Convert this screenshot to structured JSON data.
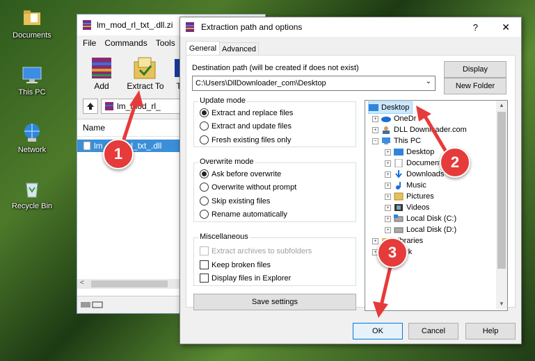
{
  "desktop": {
    "icons": [
      {
        "label": "Documents"
      },
      {
        "label": "This PC"
      },
      {
        "label": "Network"
      },
      {
        "label": "Recycle Bin"
      }
    ]
  },
  "winrar": {
    "title": "lm_mod_rl_txt_.dll.zi",
    "menu": [
      "File",
      "Commands",
      "Tools"
    ],
    "toolbar": {
      "add": "Add",
      "extract_to": "Extract To",
      "t": "T"
    },
    "path": "lm_mod_rl_",
    "list_header": "Name",
    "file": "lm_mod_rl_txt_.dll"
  },
  "dialog": {
    "title": "Extraction path and options",
    "help": "?",
    "close": "✕",
    "tabs": [
      "General",
      "Advanced"
    ],
    "dest_label": "Destination path (will be created if does not exist)",
    "dest_value": "C:\\Users\\DllDownloader_com\\Desktop",
    "display_btn": "Display",
    "new_folder_btn": "New Folder",
    "update_mode": {
      "label": "Update mode",
      "options": [
        "Extract and replace files",
        "Extract and update files",
        "Fresh existing files only"
      ],
      "selected": 0
    },
    "overwrite_mode": {
      "label": "Overwrite mode",
      "options": [
        "Ask before overwrite",
        "Overwrite without prompt",
        "Skip existing files",
        "Rename automatically"
      ],
      "selected": 0
    },
    "misc": {
      "label": "Miscellaneous",
      "options": [
        "Extract archives to subfolders",
        "Keep broken files",
        "Display files in Explorer"
      ]
    },
    "save_settings": "Save settings",
    "tree": {
      "root": "Desktop",
      "items": [
        "OneDr",
        "DLL Downloader.com",
        "This PC",
        "Desktop",
        "Document",
        "Downloads",
        "Music",
        "Pictures",
        "Videos",
        "Local Disk (C:)",
        "Local Disk (D:)",
        "Libraries",
        "twork"
      ]
    },
    "ok": "OK",
    "cancel": "Cancel",
    "help_btn": "Help"
  },
  "badges": [
    "1",
    "2",
    "3"
  ],
  "colors": {
    "badge": "#e63b3b",
    "selection": "#cce8ff",
    "accent": "#0078d7"
  }
}
